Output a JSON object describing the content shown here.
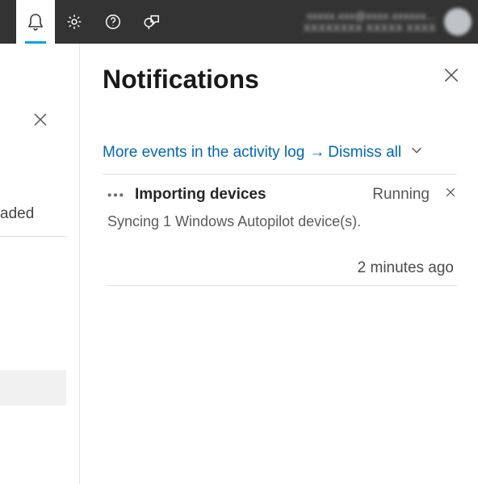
{
  "topbar": {
    "account_line1": "xxxxx.xxx@xxxx.xxxxxx...",
    "account_line2": "XXXXXXXX XXXXX XXXX"
  },
  "leftcol": {
    "truncated_label": "aded"
  },
  "panel": {
    "title": "Notifications",
    "more_link": "More events in the activity log",
    "arrow": "→",
    "dismiss_all": "Dismiss all"
  },
  "notification": {
    "title": "Importing devices",
    "status": "Running",
    "description": "Syncing 1 Windows Autopilot device(s).",
    "time": "2 minutes ago"
  }
}
